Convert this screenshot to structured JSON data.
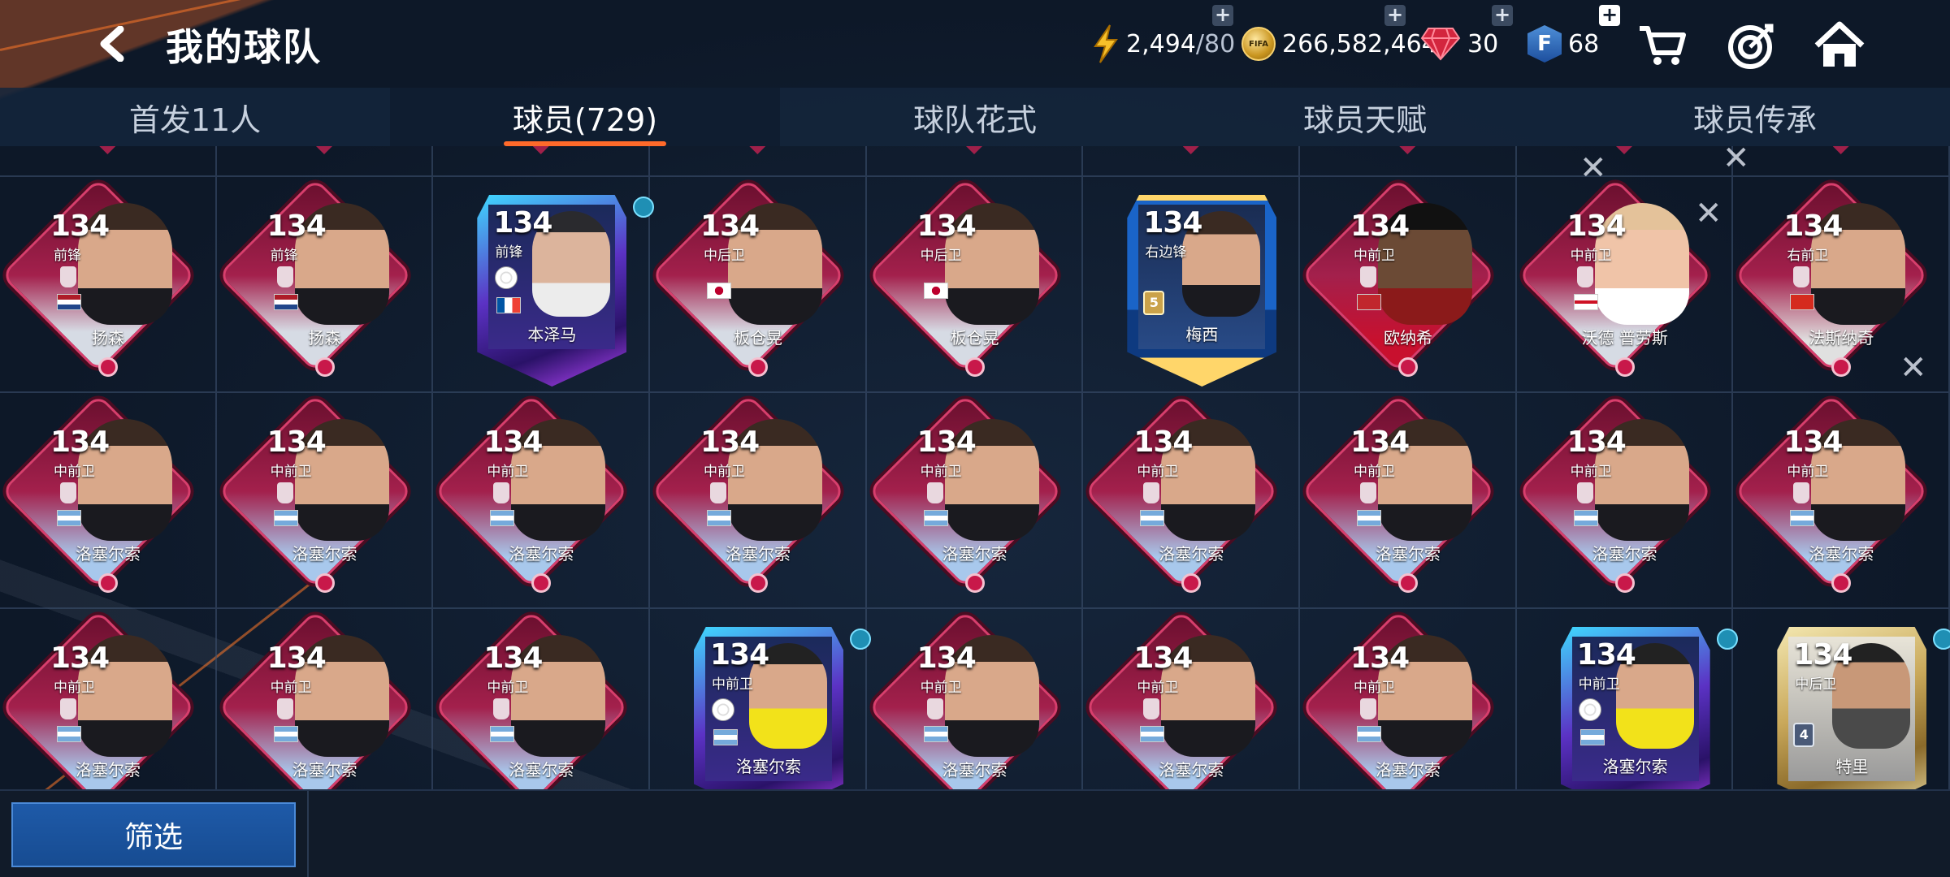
{
  "header": {
    "title": "我的球队",
    "energy": "2,494",
    "energy_max": "/80",
    "coins": "266,582,464",
    "coin_logo": "FIFA",
    "gems": "30",
    "fpoints": "68",
    "fpoints_letter": "F"
  },
  "tabs": [
    {
      "label": "首发11人"
    },
    {
      "label": "球员(729)"
    },
    {
      "label": "球队花式"
    },
    {
      "label": "球员天赋"
    },
    {
      "label": "球员传承"
    }
  ],
  "cards": [
    {
      "rating": "134",
      "pos": "前锋",
      "name": "扬森"
    },
    {
      "rating": "134",
      "pos": "前锋",
      "name": "扬森"
    },
    {
      "rating": "134",
      "pos": "前锋",
      "name": "本泽马"
    },
    {
      "rating": "134",
      "pos": "中后卫",
      "name": "板仓晃"
    },
    {
      "rating": "134",
      "pos": "中后卫",
      "name": "板仓晃"
    },
    {
      "rating": "134",
      "pos": "右边锋",
      "name": "梅西",
      "level": "5"
    },
    {
      "rating": "134",
      "pos": "中前卫",
      "name": "欧纳希"
    },
    {
      "rating": "134",
      "pos": "中前卫",
      "name": "沃德 普劳斯"
    },
    {
      "rating": "134",
      "pos": "右前卫",
      "name": "法斯纳奇"
    },
    {
      "rating": "134",
      "pos": "中前卫",
      "name": "洛塞尔索"
    },
    {
      "rating": "134",
      "pos": "中前卫",
      "name": "洛塞尔索"
    },
    {
      "rating": "134",
      "pos": "中前卫",
      "name": "洛塞尔索"
    },
    {
      "rating": "134",
      "pos": "中前卫",
      "name": "洛塞尔索"
    },
    {
      "rating": "134",
      "pos": "中前卫",
      "name": "洛塞尔索"
    },
    {
      "rating": "134",
      "pos": "中前卫",
      "name": "洛塞尔索"
    },
    {
      "rating": "134",
      "pos": "中前卫",
      "name": "洛塞尔索"
    },
    {
      "rating": "134",
      "pos": "中前卫",
      "name": "洛塞尔索"
    },
    {
      "rating": "134",
      "pos": "中前卫",
      "name": "洛塞尔索"
    },
    {
      "rating": "134",
      "pos": "中前卫",
      "name": "洛塞尔索"
    },
    {
      "rating": "134",
      "pos": "中前卫",
      "name": "洛塞尔索"
    },
    {
      "rating": "134",
      "pos": "中前卫",
      "name": "洛塞尔索"
    },
    {
      "rating": "134",
      "pos": "中前卫",
      "name": "洛塞尔索"
    },
    {
      "rating": "134",
      "pos": "中前卫",
      "name": "洛塞尔索"
    },
    {
      "rating": "134",
      "pos": "中前卫",
      "name": "洛塞尔索"
    },
    {
      "rating": "134",
      "pos": "中前卫",
      "name": "洛塞尔索"
    },
    {
      "rating": "134",
      "pos": "中前卫",
      "name": "洛塞尔索"
    },
    {
      "rating": "134",
      "pos": "中后卫",
      "name": "特里",
      "level": "4"
    }
  ],
  "footer": {
    "filter_label": "筛选"
  },
  "colors": {
    "accent": "#ff6a2a",
    "card_frame": "#d83e6c",
    "button": "#1e5aa8"
  }
}
